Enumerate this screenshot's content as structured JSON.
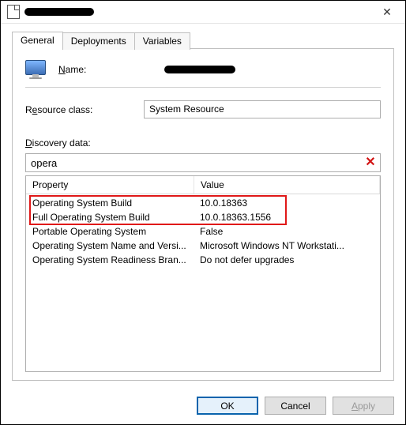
{
  "tabs": {
    "general": "General",
    "deployments": "Deployments",
    "variables": "Variables"
  },
  "name_label": "Name:",
  "resource_class": {
    "label_pre": "R",
    "label_mid": "e",
    "label_post": "source class:",
    "value": "System Resource"
  },
  "discovery_label": "Discovery data:",
  "filter_value": "opera",
  "grid": {
    "hdr_property": "Property",
    "hdr_value": "Value",
    "rows": [
      {
        "p": "Operating System Build",
        "v": "10.0.18363"
      },
      {
        "p": "Full Operating System Build",
        "v": "10.0.18363.1556"
      },
      {
        "p": "Portable Operating System",
        "v": "False"
      },
      {
        "p": "Operating System Name and Versi...",
        "v": "Microsoft Windows NT Workstati..."
      },
      {
        "p": "Operating System Readiness Bran...",
        "v": "Do not defer upgrades"
      }
    ]
  },
  "buttons": {
    "ok": "OK",
    "cancel": "Cancel",
    "apply": "Apply"
  },
  "close_glyph": "✕",
  "clear_glyph": "✕"
}
